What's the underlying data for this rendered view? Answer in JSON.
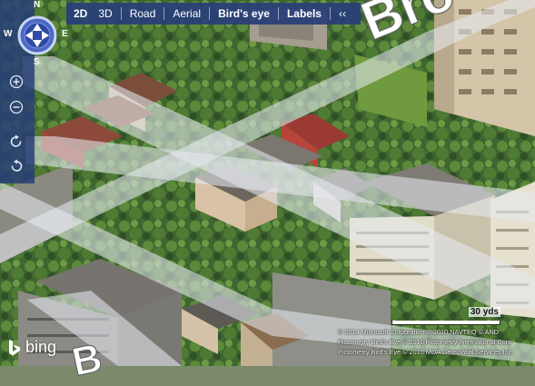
{
  "toolbar": {
    "items": [
      {
        "label": "2D",
        "active": true
      },
      {
        "label": "3D",
        "active": false
      },
      {
        "label": "Road",
        "active": false
      },
      {
        "label": "Aerial",
        "active": false
      },
      {
        "label": "Bird's eye",
        "active": true
      },
      {
        "label": "Labels",
        "active": true
      }
    ],
    "collapse": "‹‹"
  },
  "compass": {
    "n": "N",
    "s": "S",
    "e": "E",
    "w": "W"
  },
  "nav": {
    "zoom_in": "+",
    "zoom_out": "−",
    "rotate_cw": "↻",
    "rotate_ccw": "↺"
  },
  "map_labels": {
    "street_top": "Bro",
    "street_bottom": "B"
  },
  "scale": {
    "label": "30 yds"
  },
  "copyright": [
    "© 2014 Microsoft Corporation   © 2010 NAVTEQ   © AND",
    "Pictometry Bird's Eye © 2010 Pictometry International Corp",
    "Pictometry Bird's Eye © 2010 MDA Geospatial Services Inc."
  ],
  "brand": {
    "logo_text": "bing"
  },
  "colors": {
    "toolbar_bg": "#283e78",
    "road_overlay": "#e6e9ef"
  }
}
